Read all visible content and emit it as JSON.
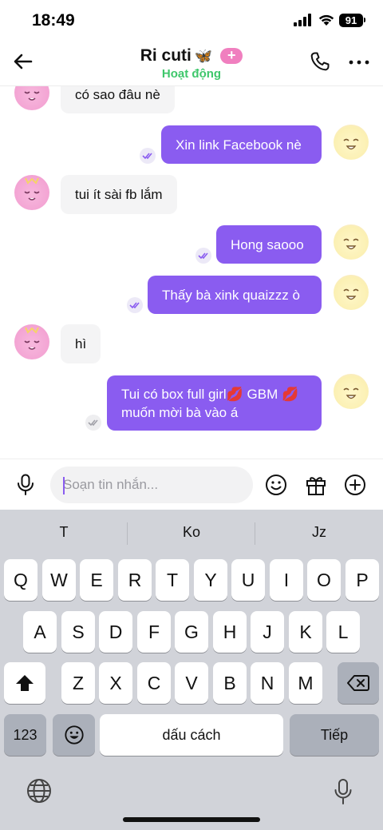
{
  "status_bar": {
    "time": "18:49",
    "battery": "91"
  },
  "header": {
    "name": "Ri cuti",
    "name_emoji": "🦋",
    "badge": "+",
    "status": "Hoạt động"
  },
  "messages": [
    {
      "side": "in",
      "text": "có sao đâu nè"
    },
    {
      "side": "out",
      "text": "Xin link Facebook nè"
    },
    {
      "side": "in",
      "text": "tui ít sài fb lắm"
    },
    {
      "side": "out",
      "text": "Hong saooo"
    },
    {
      "side": "out",
      "text": "Thấy bà xink quaizzz ò"
    },
    {
      "side": "in",
      "text": "hì"
    },
    {
      "side": "out",
      "text_line1": "Tui có box full girl💋 GBM 💋",
      "text_line2": "muốn mời bà vào á"
    }
  ],
  "composer": {
    "placeholder": "Soạn tin nhắn..."
  },
  "keyboard": {
    "suggestions": [
      "T",
      "Ko",
      "Jz"
    ],
    "row1": [
      "Q",
      "W",
      "E",
      "R",
      "T",
      "Y",
      "U",
      "I",
      "O",
      "P"
    ],
    "row2": [
      "A",
      "S",
      "D",
      "F",
      "G",
      "H",
      "J",
      "K",
      "L"
    ],
    "row3": [
      "Z",
      "X",
      "C",
      "V",
      "B",
      "N",
      "M"
    ],
    "numbers_key": "123",
    "space_key": "dấu cách",
    "return_key": "Tiếp"
  },
  "colors": {
    "outgoing_bubble": "#8a5cf0",
    "incoming_bubble": "#f4f4f5",
    "active_status": "#3ec76b",
    "badge": "#f07fbf"
  }
}
